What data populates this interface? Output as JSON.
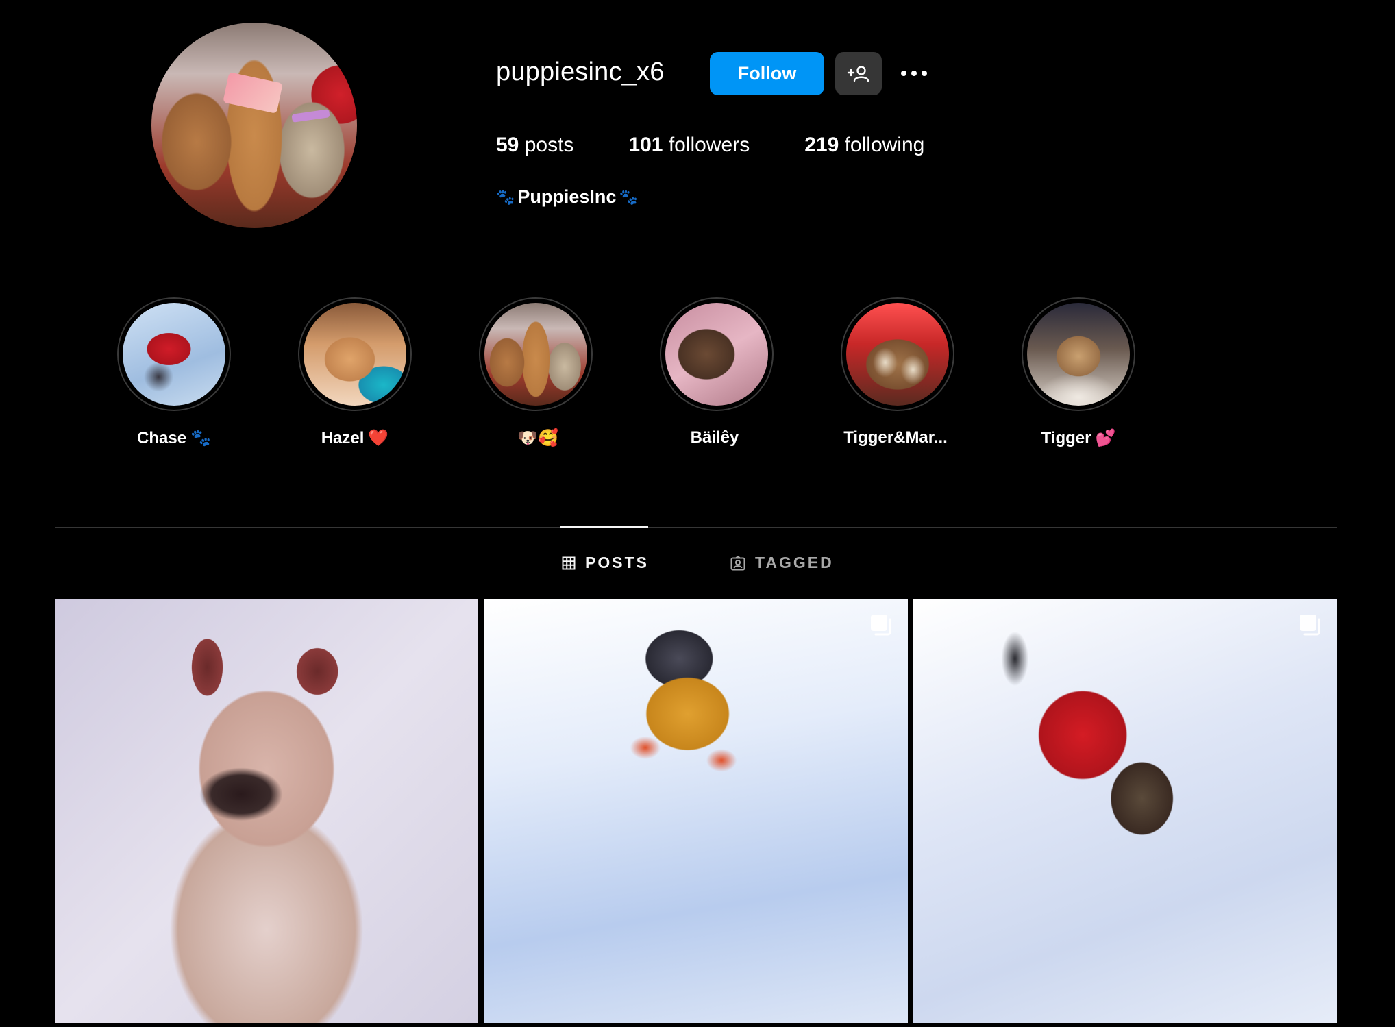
{
  "profile": {
    "username": "puppiesinc_x6",
    "follow_label": "Follow",
    "posts_count": "59",
    "posts_label": " posts",
    "followers_count": "101",
    "followers_label": " followers",
    "following_count": "219",
    "following_label": " following",
    "display_name": "PuppiesInc",
    "accent_color": "#0095f6"
  },
  "highlights": [
    {
      "label": "Chase",
      "emoji": "🐾"
    },
    {
      "label": "Hazel",
      "emoji": "❤️"
    },
    {
      "label": "",
      "emoji": "🐶🥰"
    },
    {
      "label": "Bäilêy",
      "emoji": ""
    },
    {
      "label": "Tigger&Mar...",
      "emoji": ""
    },
    {
      "label": "Tigger",
      "emoji": "💕"
    }
  ],
  "tabs": {
    "posts": "POSTS",
    "tagged": "TAGGED"
  },
  "icons": {
    "suggest": "add-person-icon",
    "more": "more-options-icon",
    "posts_tab": "grid-icon",
    "tagged_tab": "tagged-icon",
    "multi": "carousel-icon"
  }
}
